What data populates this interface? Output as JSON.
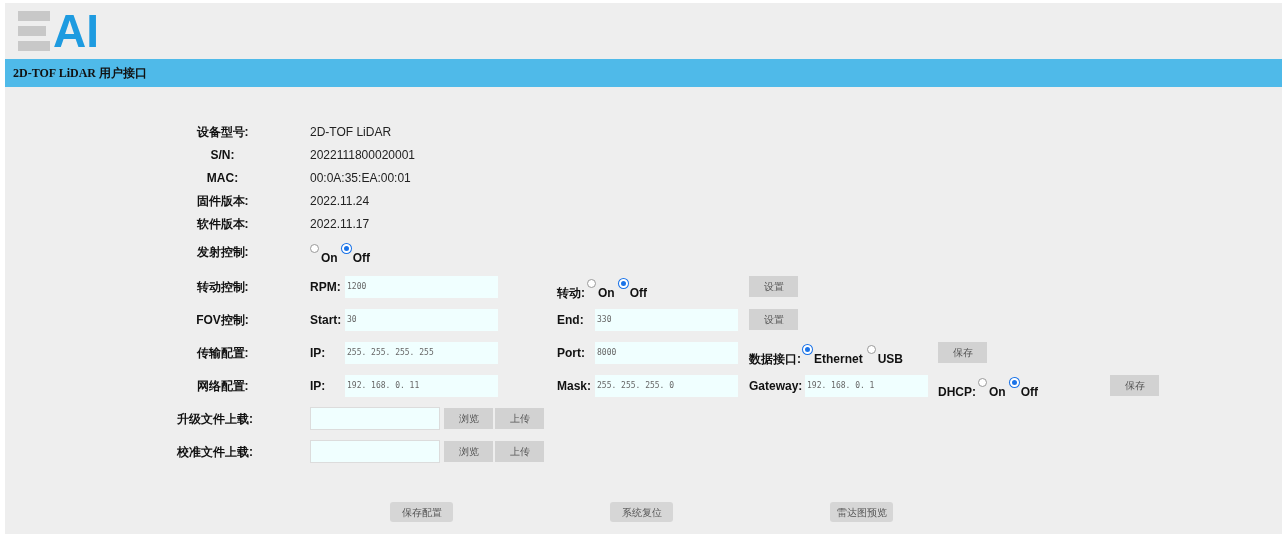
{
  "logo": {
    "text": "AI"
  },
  "title_bar": "2D-TOF LiDAR 用户接口",
  "info": [
    {
      "label": "设备型号:",
      "value": "2D-TOF LiDAR"
    },
    {
      "label": "S/N:",
      "value": "2022111800020001"
    },
    {
      "label": "MAC:",
      "value": "00:0A:35:EA:00:01"
    },
    {
      "label": "固件版本:",
      "value": "2022.11.24"
    },
    {
      "label": "软件版本:",
      "value": "2022.11.17"
    }
  ],
  "emit": {
    "label": "发射控制:",
    "options": [
      {
        "label": "On",
        "selected": false
      },
      {
        "label": "Off",
        "selected": true
      }
    ]
  },
  "rows": [
    {
      "label": "转动控制:",
      "items": [
        {
          "kind": "field",
          "label": "RPM:",
          "value": "1200"
        },
        {
          "kind": "radio",
          "label": "转动:",
          "options": [
            {
              "label": "On",
              "selected": false
            },
            {
              "label": "Off",
              "selected": true
            }
          ]
        },
        {
          "kind": "button",
          "label": "设置"
        }
      ]
    },
    {
      "label": "FOV控制:",
      "items": [
        {
          "kind": "field",
          "label": "Start:",
          "value": "30"
        },
        {
          "kind": "field",
          "label": "End:",
          "value": "330"
        },
        {
          "kind": "button",
          "label": "设置"
        }
      ]
    },
    {
      "label": "传输配置:",
      "items": [
        {
          "kind": "field",
          "label": "IP:",
          "value": "255. 255. 255. 255"
        },
        {
          "kind": "field",
          "label": "Port:",
          "value": "8000"
        },
        {
          "kind": "radio",
          "label": "数据接口:",
          "options": [
            {
              "label": "Ethernet",
              "selected": true
            },
            {
              "label": "USB",
              "selected": false
            }
          ]
        },
        {
          "kind": "button",
          "label": "保存"
        }
      ]
    },
    {
      "label": "网络配置:",
      "items": [
        {
          "kind": "field",
          "label": "IP:",
          "value": "192. 168. 0. 11"
        },
        {
          "kind": "field",
          "label": "Mask:",
          "value": "255. 255. 255. 0"
        },
        {
          "kind": "field",
          "label": "Gateway:",
          "value": "192. 168. 0. 1"
        },
        {
          "kind": "radio",
          "label": "DHCP:",
          "options": [
            {
              "label": "On",
              "selected": false
            },
            {
              "label": "Off",
              "selected": true
            }
          ]
        },
        {
          "kind": "button",
          "label": "保存"
        }
      ]
    }
  ],
  "uploads": [
    {
      "label": "升级文件上载:",
      "buttons": [
        "浏览",
        "上传"
      ]
    },
    {
      "label": "校准文件上载:",
      "buttons": [
        "浏览",
        "上传"
      ]
    }
  ],
  "footer_buttons": [
    "保存配置",
    "系统复位",
    "雷达图预览"
  ]
}
